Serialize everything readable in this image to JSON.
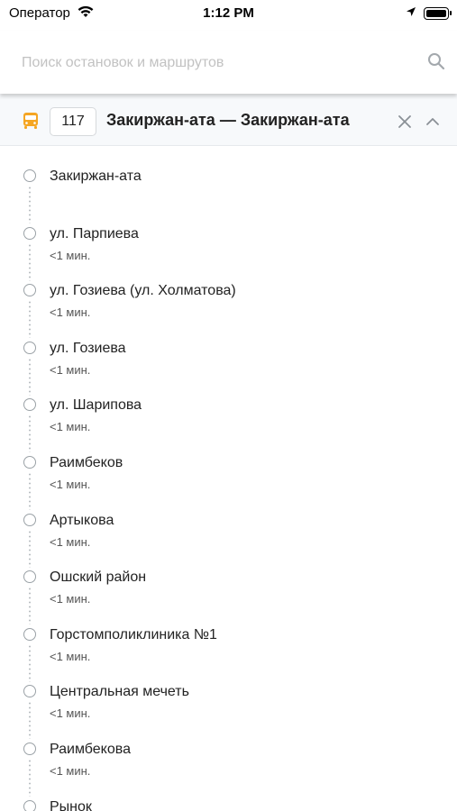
{
  "status_bar": {
    "carrier": "Оператор",
    "time": "1:12 PM"
  },
  "search": {
    "placeholder": "Поиск остановок и маршрутов",
    "value": ""
  },
  "route": {
    "number": "117",
    "title": "Закиржан-ата — Закиржан-ата",
    "accent_color": "#f5a623"
  },
  "stops": [
    {
      "name": "Закиржан-ата",
      "eta": ""
    },
    {
      "name": "ул. Парпиева",
      "eta": "<1 мин."
    },
    {
      "name": "ул. Гозиева (ул. Холматова)",
      "eta": "<1 мин."
    },
    {
      "name": "ул. Гозиева",
      "eta": "<1 мин."
    },
    {
      "name": "ул. Шарипова",
      "eta": "<1 мин."
    },
    {
      "name": "Раимбеков",
      "eta": "<1 мин."
    },
    {
      "name": "Артыкова",
      "eta": "<1 мин."
    },
    {
      "name": "Ошский район",
      "eta": "<1 мин."
    },
    {
      "name": "Горстомполиклиника №1",
      "eta": "<1 мин."
    },
    {
      "name": "Центральная мечеть",
      "eta": "<1 мин."
    },
    {
      "name": "Раимбекова",
      "eta": "<1 мин."
    },
    {
      "name": "Рынок",
      "eta": ""
    }
  ]
}
